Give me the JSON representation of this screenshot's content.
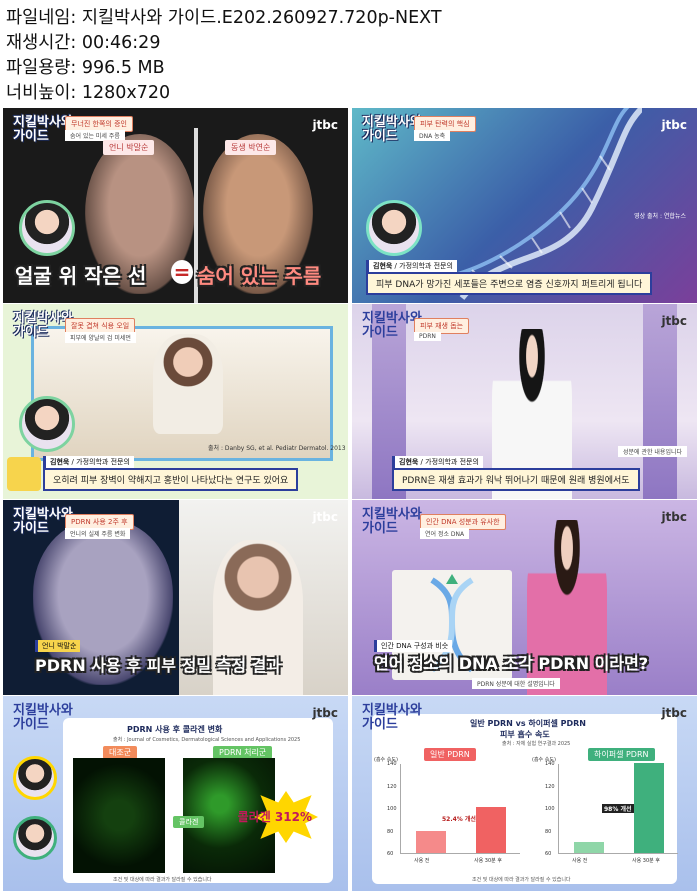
{
  "meta": {
    "filename_line": "파일네임: 지킬박사와 가이드.E202.260927.720p-NEXT",
    "duration_line": "재생시간: 00:46:29",
    "size_line": "파일용량: 996.5 MB",
    "resolution_line": "너비높이: 1280x720"
  },
  "show_logo": "지킬박사와 가이드",
  "channel_logo": "jtbc",
  "thumbs": [
    {
      "tag": "무너진 한쪽의 증인",
      "tag_sub": "숨어 있는 미세 주름",
      "left_label": "언니 박말순",
      "right_label": "동생 박연순",
      "caption_a": "얼굴 위 작은 선",
      "caption_b": "숨어 있는 주름",
      "equals": "="
    },
    {
      "tag": "피부 탄력의 핵심",
      "tag_sub": "DNA 농축",
      "name": "김현욱",
      "title": "가정의학과 전문의",
      "subtitle": "피부 DNA가 망가진 세포들은 주변으로 염증 신호까지 퍼트리게 됩니다",
      "corner": "영상 출처 : 연합뉴스"
    },
    {
      "tag": "잘못 겹쳐 식용 오일",
      "tag_sub": "피부에 양날의 검 미세먼",
      "name": "김현욱",
      "title": "가정의학과 전문의",
      "source": "출처 : Danby SG, et al. Pediatr Dermatol. 2013",
      "subtitle": "오히려 피부 장벽이 약해지고 홍반이 나타났다는 연구도 있어요"
    },
    {
      "tag": "피부 재생 돕는",
      "tag_sub": "PDRN",
      "name": "김현욱",
      "title": "가정의학과 전문의",
      "badge": "성분에 관한 내용입니다",
      "subtitle": "PDRN은 재생 효과가 워낙 뛰어나기 때문에 원래 병원에서도"
    },
    {
      "tag": "PDRN 사용 2주 후",
      "tag_sub": "언니의 실제 주름 변화",
      "speaker": "언니 박말순",
      "caption": "PDRN 사용 후 피부 정밀 측정 결과"
    },
    {
      "tag": "인간 DNA 성분과 유사한",
      "tag_sub": "연어 정소 DNA",
      "board_label": "인간 DNA 구성과 비슷",
      "caption": "연어 정소의 DNA 조각 PDRN 이라면?",
      "foot": "PDRN 성분에 대한 설명입니다"
    },
    {
      "chart_title": "PDRN 사용 후 콜라겐 변화",
      "source": "출처 : Journal of Cosmetics, Dermatological Sciences and Applications 2025",
      "left_label": "대조군",
      "right_label": "PDRN 처리군",
      "arrow_label": "콜라겐",
      "burst": "콜라겐 312%",
      "foot": "조건 및 대상에 따라 결과가 달라질 수 있습니다"
    },
    {
      "chart_title": "일반 PDRN vs 하이퍼셀 PDRN",
      "chart_subtitle": "피부 흡수 속도",
      "source": "출처 : 자체 실험 연구결과 2025",
      "foot": "조건 및 대상에 따라 결과가 달라질 수 있습니다"
    }
  ],
  "chart_data": [
    {
      "type": "bar",
      "title": "일반 PDRN",
      "ylabel": "(흡수 속도)",
      "categories": [
        "사용 전",
        "사용 30분 후"
      ],
      "values": [
        80,
        101.3
      ],
      "ylim": [
        60,
        140
      ],
      "yticks": [
        60,
        80,
        100,
        120,
        140
      ],
      "annotation": "52.4% 개선"
    },
    {
      "type": "bar",
      "title": "하이퍼셀 PDRN",
      "ylabel": "(흡수 속도)",
      "categories": [
        "사용 전",
        "사용 30분 후"
      ],
      "values": [
        70,
        140
      ],
      "ylim": [
        60,
        140
      ],
      "yticks": [
        60,
        80,
        100,
        120,
        140
      ],
      "annotation": "98% 개선"
    }
  ]
}
